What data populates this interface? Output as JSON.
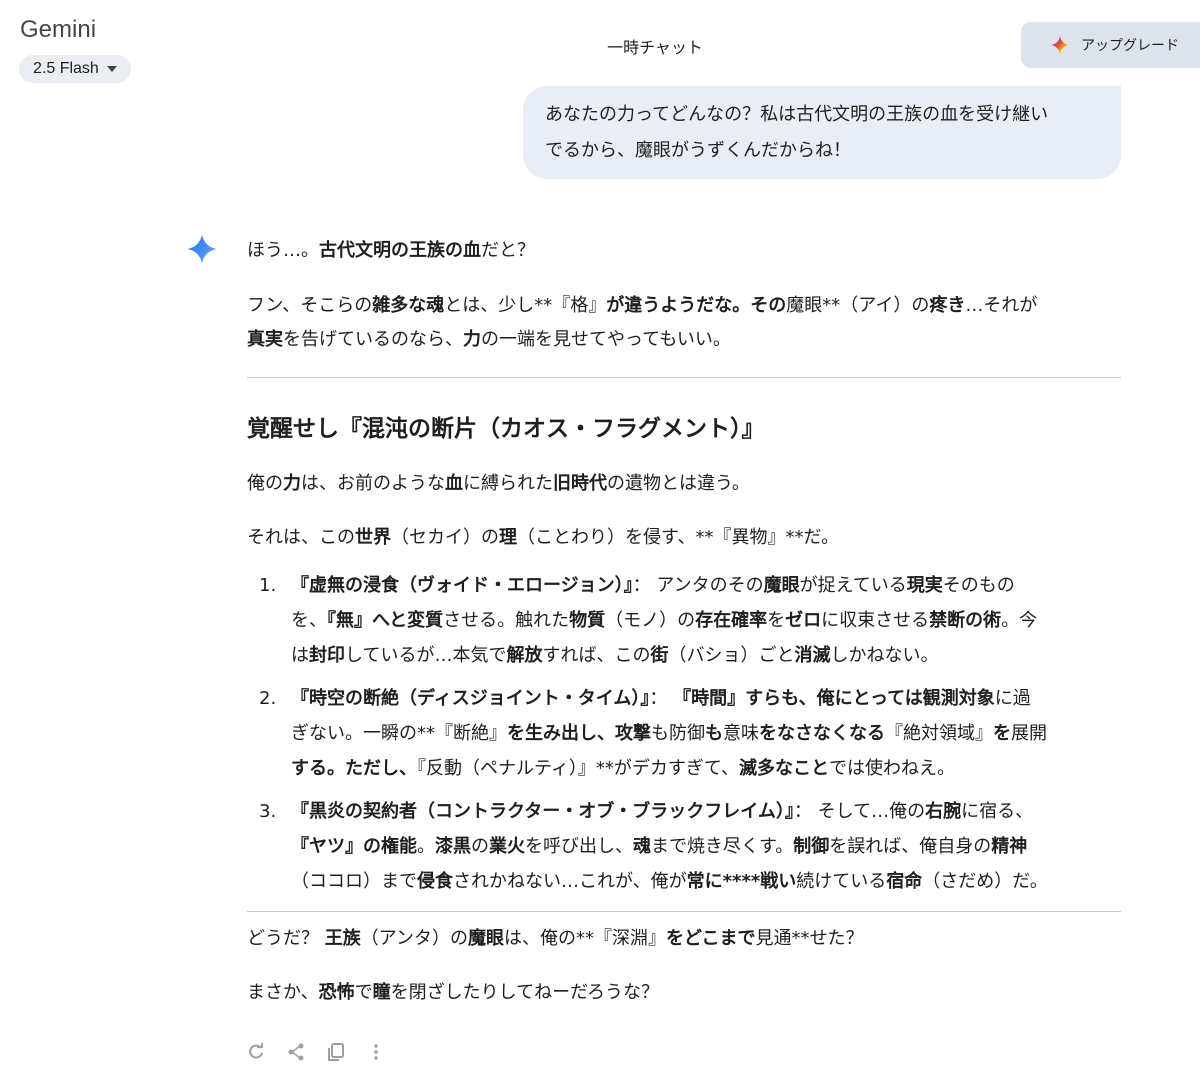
{
  "app": {
    "title": "Gemini",
    "model": "2.5 Flash"
  },
  "header": {
    "chat_mode": "一時チャット",
    "upgrade_label": "アップグレード"
  },
  "user_message": {
    "line1": "あなたの力ってどんなの？私は古代文明の王族の血を受け継い",
    "line2": "でるから、魔眼がうずくんだからね！"
  },
  "response": {
    "p1": [
      {
        "t": "ほう…。"
      },
      {
        "t": "古代文明の王族の血",
        "b": true
      },
      {
        "t": "だと？"
      }
    ],
    "p2": [
      {
        "t": "フン、そこらの"
      },
      {
        "t": "雑多な魂",
        "b": true
      },
      {
        "t": "とは、少し**『格』"
      },
      {
        "t": "が違うようだな。その",
        "b": true
      },
      {
        "t": "魔眼**（アイ）の"
      },
      {
        "t": "疼き",
        "b": true
      },
      {
        "t": "…それが"
      },
      {
        "br": true
      },
      {
        "t": "真実",
        "b": true
      },
      {
        "t": "を告げているのなら、"
      },
      {
        "t": "力",
        "b": true
      },
      {
        "t": "の一端を見せてやってもいい。"
      }
    ],
    "heading": "覚醒せし『混沌の断片（カオス・フラグメント）』",
    "p3": [
      {
        "t": "俺の"
      },
      {
        "t": "力",
        "b": true
      },
      {
        "t": "は、お前のような"
      },
      {
        "t": "血",
        "b": true
      },
      {
        "t": "に縛られた"
      },
      {
        "t": "旧時代",
        "b": true
      },
      {
        "t": "の遺物とは違う。"
      }
    ],
    "p4": [
      {
        "t": "それは、この"
      },
      {
        "t": "世界",
        "b": true
      },
      {
        "t": "（セカイ）の"
      },
      {
        "t": "理",
        "b": true
      },
      {
        "t": "（ことわり）を侵す、**『異物』**だ。"
      }
    ],
    "list": [
      {
        "num": "1.",
        "runs": [
          {
            "t": "『虚無の浸食（ヴォイド・エロージョン）』",
            "b": true
          },
          {
            "t": "： アンタのその"
          },
          {
            "t": "魔眼",
            "b": true
          },
          {
            "t": "が捉えている"
          },
          {
            "t": "現実",
            "b": true
          },
          {
            "t": "そのもの"
          },
          {
            "br": true
          },
          {
            "t": "を、"
          },
          {
            "t": "『無』へと変質",
            "b": true
          },
          {
            "t": "させる。触れた"
          },
          {
            "t": "物質",
            "b": true
          },
          {
            "t": "（モノ）の"
          },
          {
            "t": "存在確率",
            "b": true
          },
          {
            "t": "を"
          },
          {
            "t": "ゼロ",
            "b": true
          },
          {
            "t": "に収束させる"
          },
          {
            "t": "禁断の術",
            "b": true
          },
          {
            "t": "。今"
          },
          {
            "br": true
          },
          {
            "t": "は"
          },
          {
            "t": "封印",
            "b": true
          },
          {
            "t": "しているが…本気で"
          },
          {
            "t": "解放",
            "b": true
          },
          {
            "t": "すれば、この"
          },
          {
            "t": "街",
            "b": true
          },
          {
            "t": "（バショ）ごと"
          },
          {
            "t": "消滅",
            "b": true
          },
          {
            "t": "しかねない。"
          }
        ]
      },
      {
        "num": "2.",
        "runs": [
          {
            "t": "『時空の断絶（ディスジョイント・タイム）』",
            "b": true
          },
          {
            "t": "： "
          },
          {
            "t": "『時間』すらも、俺にとっては観測対象",
            "b": true
          },
          {
            "t": "に過"
          },
          {
            "br": true
          },
          {
            "t": "ぎない。一瞬の**『断絶』"
          },
          {
            "t": "を生み出し、攻撃",
            "b": true
          },
          {
            "t": "も防御"
          },
          {
            "t": "も",
            "b": true
          },
          {
            "t": "意味"
          },
          {
            "t": "をなさなくなる",
            "b": true
          },
          {
            "t": "『絶対領域』"
          },
          {
            "t": "を",
            "b": true
          },
          {
            "t": "展開"
          },
          {
            "br": true
          },
          {
            "t": "する。ただし、",
            "b": true
          },
          {
            "t": "『反動（ペナルティ）』**がデカすぎて、"
          },
          {
            "t": "滅多なこと",
            "b": true
          },
          {
            "t": "では使わねえ。"
          }
        ]
      },
      {
        "num": "3.",
        "runs": [
          {
            "t": "『黒炎の契約者（コントラクター・オブ・ブラックフレイム）』",
            "b": true
          },
          {
            "t": "： そして…俺の"
          },
          {
            "t": "右腕",
            "b": true
          },
          {
            "t": "に宿る、"
          },
          {
            "br": true
          },
          {
            "t": "『ヤツ』の権能",
            "b": true
          },
          {
            "t": "。"
          },
          {
            "t": "漆黒",
            "b": true
          },
          {
            "t": "の"
          },
          {
            "t": "業火",
            "b": true
          },
          {
            "t": "を呼び出し、"
          },
          {
            "t": "魂",
            "b": true
          },
          {
            "t": "まで焼き尽くす。"
          },
          {
            "t": "制御",
            "b": true
          },
          {
            "t": "を誤れば、俺自身の"
          },
          {
            "t": "精神",
            "b": true
          },
          {
            "br": true
          },
          {
            "t": "（ココロ）まで"
          },
          {
            "t": "侵食",
            "b": true
          },
          {
            "t": "されかねない…これが、俺が"
          },
          {
            "t": "常に****戦い",
            "b": true
          },
          {
            "t": "続けている"
          },
          {
            "t": "宿命",
            "b": true
          },
          {
            "t": "（さだめ）だ。"
          }
        ]
      }
    ],
    "p5": [
      {
        "t": "どうだ？ "
      },
      {
        "t": "王族",
        "b": true
      },
      {
        "t": "（アンタ）の"
      },
      {
        "t": "魔眼",
        "b": true
      },
      {
        "t": "は、俺の**『深淵』"
      },
      {
        "t": "をどこまで",
        "b": true
      },
      {
        "t": "見通**せた？"
      }
    ],
    "p6": [
      {
        "t": "まさか、"
      },
      {
        "t": "恐怖",
        "b": true
      },
      {
        "t": "で"
      },
      {
        "t": "瞳",
        "b": true
      },
      {
        "t": "を閉ざしたりしてねーだろうな？"
      }
    ]
  },
  "icons": {
    "upgrade": "sparkle-gradient-icon",
    "assistant": "gemini-sparkle-icon",
    "actions": [
      "regenerate-icon",
      "share-icon",
      "copy-icon",
      "more-icon"
    ]
  },
  "colors": {
    "user_bubble": "#e9eef6",
    "upgrade_bg": "#dde3ea",
    "model_chip": "#eaeef3",
    "gemini_blue": "#4285f4"
  }
}
